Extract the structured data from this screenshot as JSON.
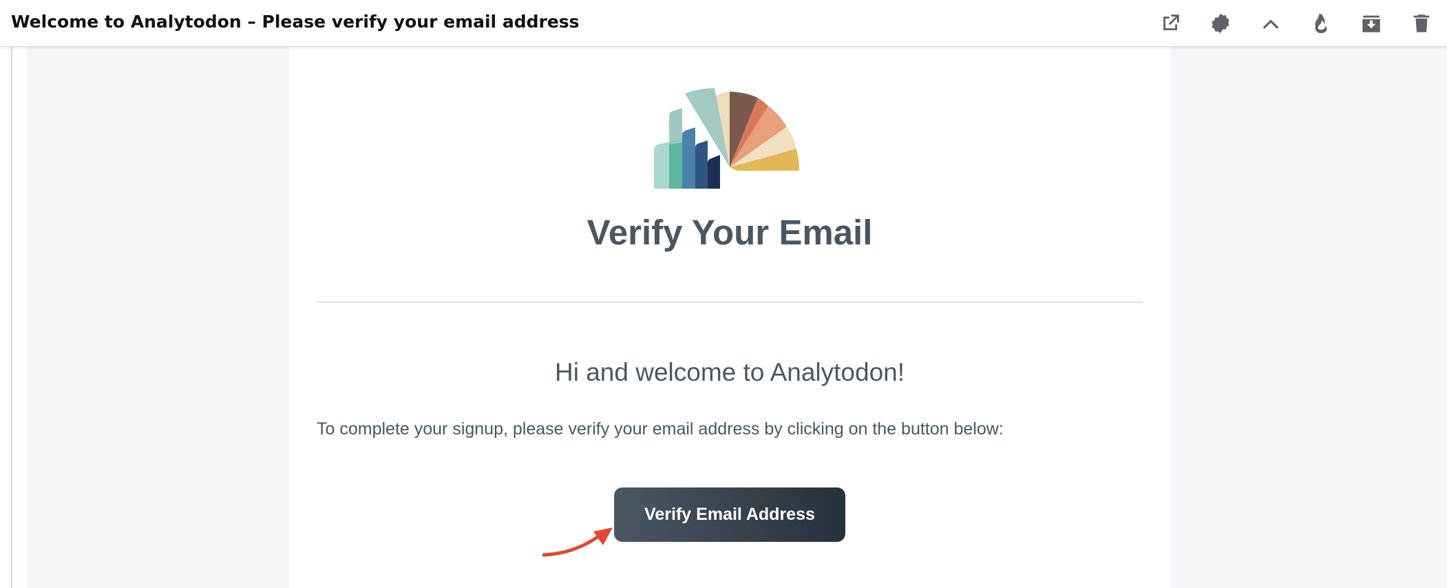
{
  "header": {
    "subject": "Welcome to Analytodon – Please verify your email address",
    "actions": [
      {
        "name": "open-external-icon",
        "label": "Open in new window"
      },
      {
        "name": "badge-icon",
        "label": "Badge"
      },
      {
        "name": "chevron-up-icon",
        "label": "Collapse"
      },
      {
        "name": "flame-icon",
        "label": "Hot"
      },
      {
        "name": "archive-icon",
        "label": "Archive"
      },
      {
        "name": "trash-icon",
        "label": "Delete"
      }
    ]
  },
  "email": {
    "heading": "Verify Your Email",
    "greeting": "Hi and welcome to Analytodon!",
    "instruction": "To complete your signup, please verify your email address by clicking on the button below:",
    "button_label": "Verify Email Address"
  },
  "colors": {
    "accent_arrow": "#e8452c",
    "button_start": "#4a5864",
    "button_end": "#25323b",
    "text": "#4a5762"
  }
}
